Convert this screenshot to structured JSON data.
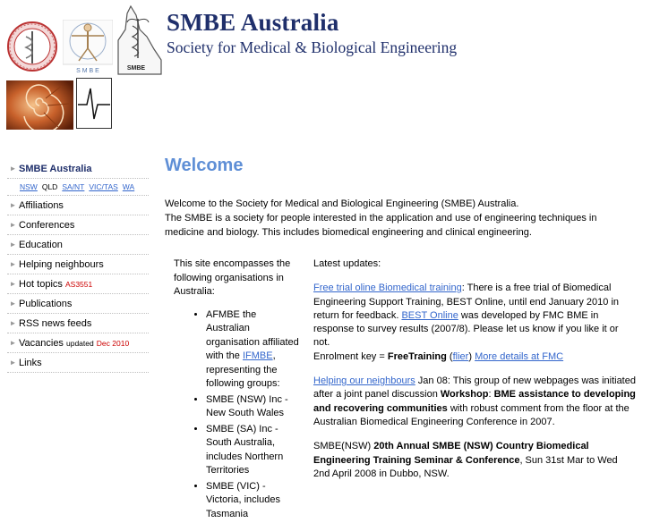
{
  "header": {
    "title": "SMBE Australia",
    "subtitle": "Society for Medical & Biological Engineering",
    "logo_text_smbe": "S M B E",
    "logo_text_qld": "SMBE"
  },
  "sidebar": {
    "items": [
      {
        "label": "SMBE Australia",
        "active": true
      },
      {
        "label": "Affiliations"
      },
      {
        "label": "Conferences"
      },
      {
        "label": "Education"
      },
      {
        "label": "Helping neighbours"
      },
      {
        "label": "Hot topics",
        "badge": "AS3551"
      },
      {
        "label": "Publications"
      },
      {
        "label": "RSS news feeds"
      },
      {
        "label": "Vacancies",
        "note": "updated",
        "badge": "Dec 2010"
      },
      {
        "label": "Links"
      }
    ],
    "states": [
      "NSW",
      "QLD",
      "SA/NT",
      "VIC/TAS",
      "WA"
    ]
  },
  "main": {
    "heading": "Welcome",
    "intro_line1": "Welcome to the Society for Medical and Biological Engineering (SMBE) Australia.",
    "intro_line2": "The SMBE is a society for people interested in the application and use of engineering techniques in medicine and biology. This includes biomedical engineering and clinical engineering.",
    "left": {
      "lead": "This site encompasses the following organisations in Australia:",
      "bullet1_pre": "AFMBE the Australian organisation affiliated with the ",
      "bullet1_link": "IFMBE",
      "bullet1_post": ", representing the following groups:",
      "bullet2": "SMBE (NSW) Inc - New South Wales",
      "bullet3": "SMBE (SA) Inc - South Australia, includes Northern Territories",
      "bullet4": "SMBE (VIC) - Victoria, includes Tasmania"
    },
    "right": {
      "latest": "Latest updates:",
      "p1_link1": "Free trial oline Biomedical training",
      "p1_text1": ": There is a free trial of Biomedical Engineering Support Training, BEST Online, until end January 2010 in return for feedback. ",
      "p1_link2": "BEST Online",
      "p1_text2": " was developed by FMC BME in response to survey results (2007/8). Please let us know if you like it or not.",
      "p1_enrol": "Enrolment key = ",
      "p1_key": "FreeTraining",
      "p1_flier": "flier",
      "p1_more": "More details at FMC",
      "p2_link": "Helping our neighbours",
      "p2_text1": " Jan 08: This group of new webpages was initiated after a joint panel discussion ",
      "p2_bold1": "Workshop",
      "p2_colon": ": ",
      "p2_bold2": "BME assistance to developing and recovering communities",
      "p2_text2": " with robust comment from the floor at the Australian Biomedical Engineering Conference in 2007.",
      "p3_pre": "SMBE(NSW) ",
      "p3_bold": "20th Annual SMBE (NSW) Country Biomedical Engineering Training Seminar & Conference",
      "p3_post": ", Sun 31st Mar to Wed 2nd April 2008 in Dubbo, NSW."
    }
  },
  "colors": {
    "title": "#1f2f6b",
    "heading": "#5f8fd6",
    "link": "#3366cc",
    "badge": "#cc0000"
  }
}
